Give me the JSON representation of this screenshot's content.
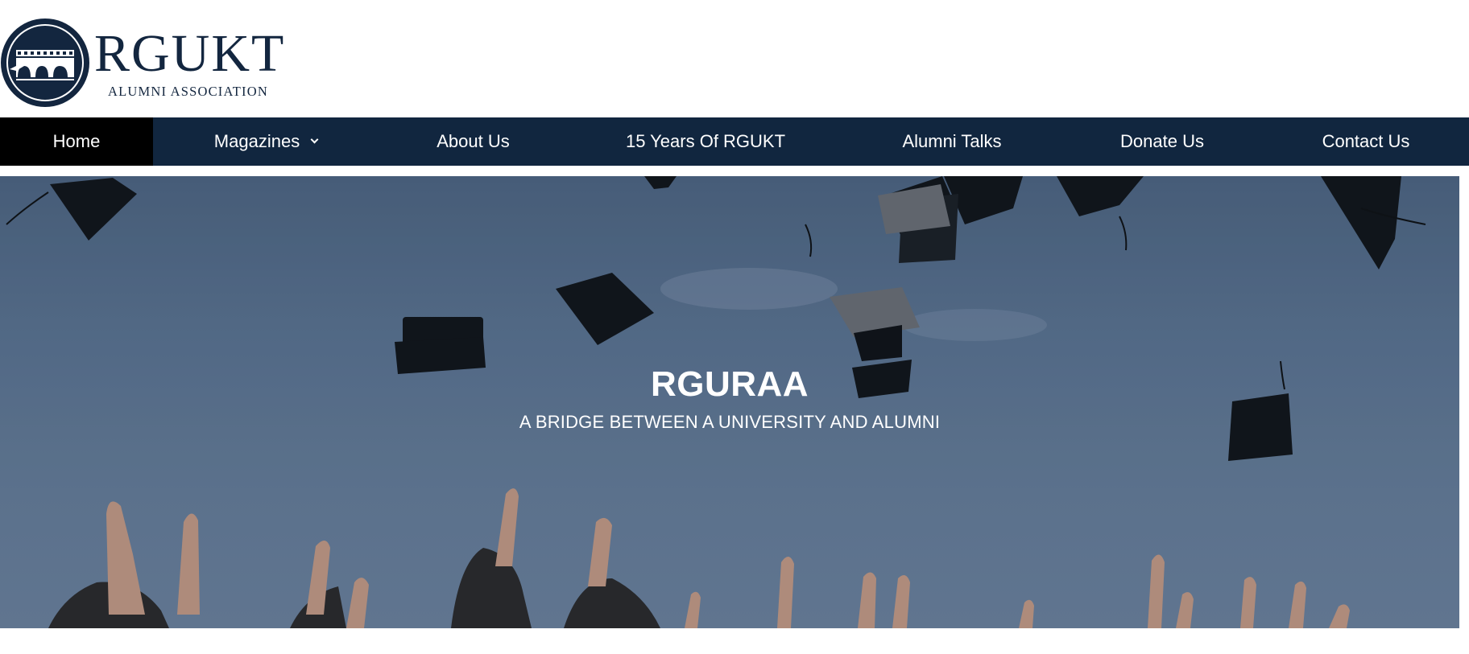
{
  "logo": {
    "name": "RGUKT",
    "subtitle": "ALUMNI ASSOCIATION"
  },
  "nav": {
    "items": [
      {
        "label": "Home",
        "active": true
      },
      {
        "label": "Magazines",
        "has_dropdown": true
      },
      {
        "label": "About Us"
      },
      {
        "label": "15 Years Of RGUKT"
      },
      {
        "label": "Alumni Talks"
      },
      {
        "label": "Donate Us"
      },
      {
        "label": "Contact Us"
      }
    ]
  },
  "hero": {
    "title": "RGURAA",
    "subtitle": "A BRIDGE BETWEEN A UNIVERSITY AND ALUMNI"
  },
  "colors": {
    "brand_navy": "#11263f",
    "active_nav": "#000000",
    "text_on_dark": "#ffffff"
  },
  "icons": {
    "logo_emblem": "arched-bridge-emblem",
    "dropdown": "chevron-down-icon"
  }
}
